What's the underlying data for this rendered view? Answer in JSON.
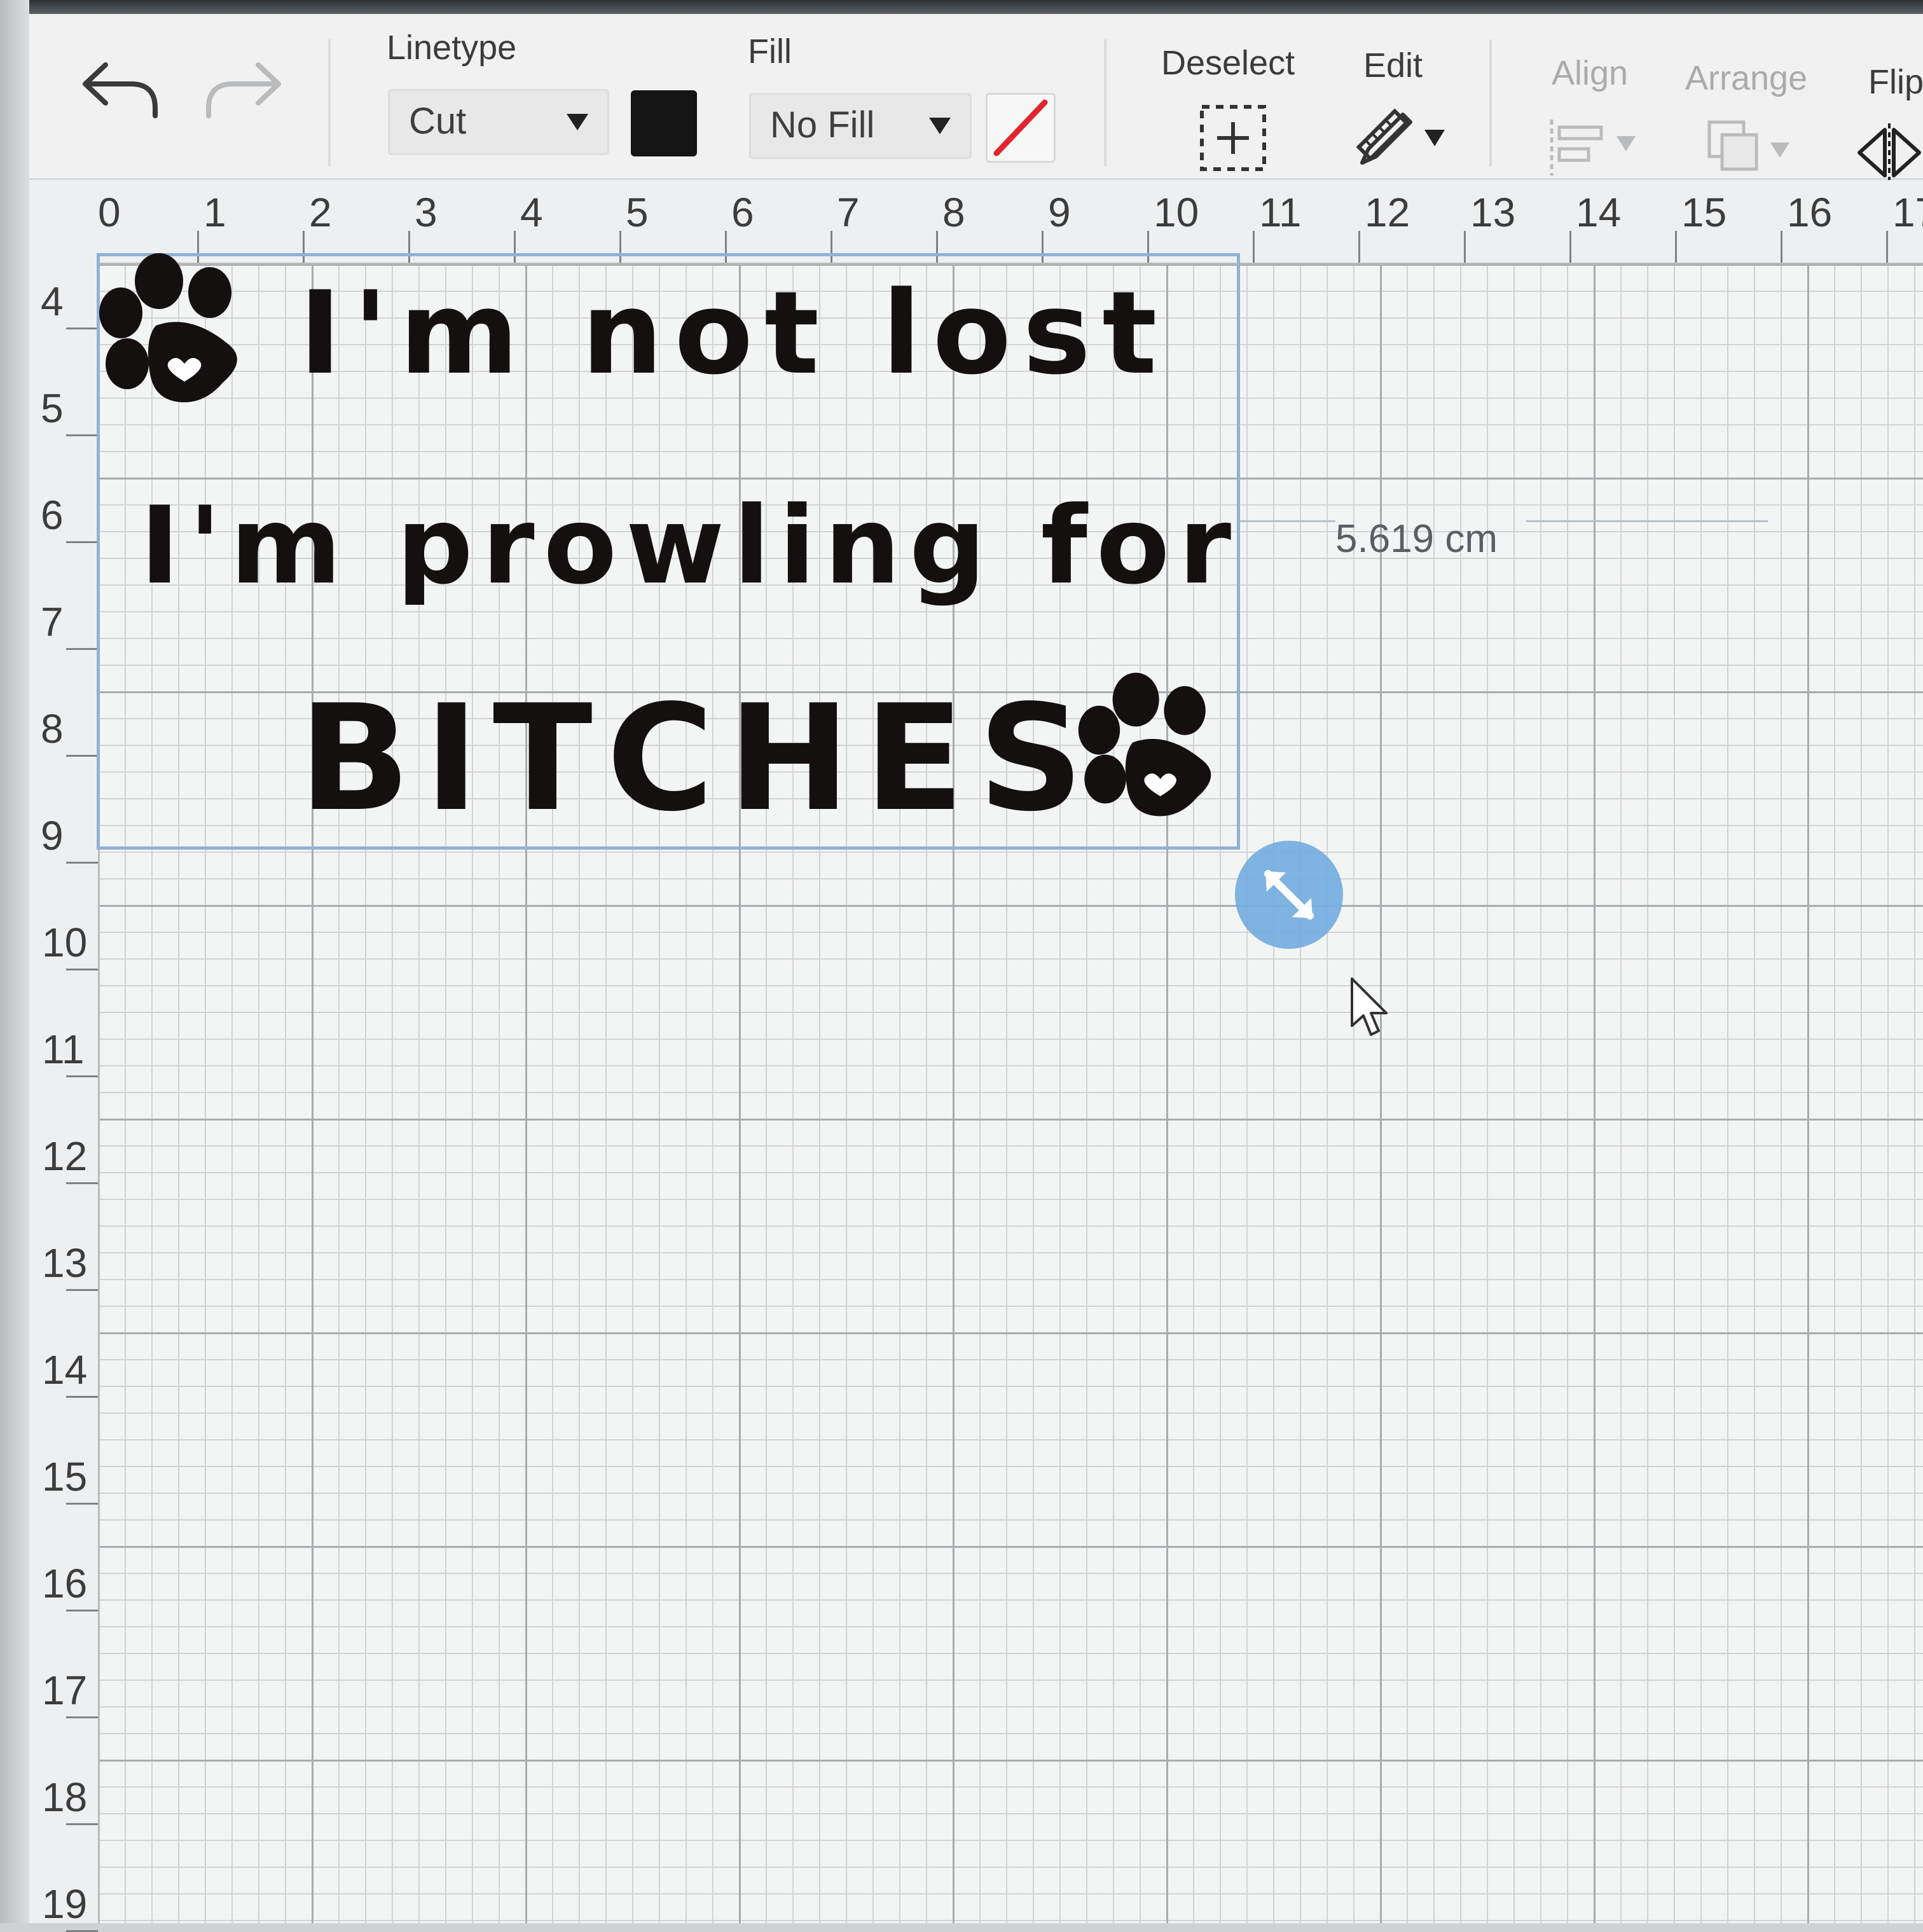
{
  "toolbar": {
    "undo_icon": "undo-icon",
    "redo_icon": "redo-icon",
    "linetype_label": "Linetype",
    "linetype_value": "Cut",
    "linetype_color": "#141414",
    "fill_label": "Fill",
    "fill_value": "No Fill",
    "deselect_label": "Deselect",
    "edit_label": "Edit",
    "align_label": "Align",
    "arrange_label": "Arrange",
    "flip_label": "Flip"
  },
  "ruler": {
    "top": [
      "0",
      "1",
      "2",
      "3",
      "4",
      "5",
      "6",
      "7",
      "8",
      "9",
      "10",
      "11",
      "12",
      "13",
      "14",
      "15",
      "16",
      "17"
    ],
    "left": [
      "4",
      "5",
      "6",
      "7",
      "8",
      "9",
      "10",
      "11",
      "12",
      "13",
      "14",
      "15",
      "16",
      "17",
      "18",
      "19"
    ]
  },
  "design": {
    "line1": "I'm not lost",
    "line2": "I'm prowling for",
    "line3": "BITCHES",
    "selection_color": "#8fb2d6"
  },
  "dimension": {
    "label": "5.619 cm"
  },
  "colors": {
    "accent": "#76aee0",
    "no_fill_slash": "#e0262b"
  }
}
